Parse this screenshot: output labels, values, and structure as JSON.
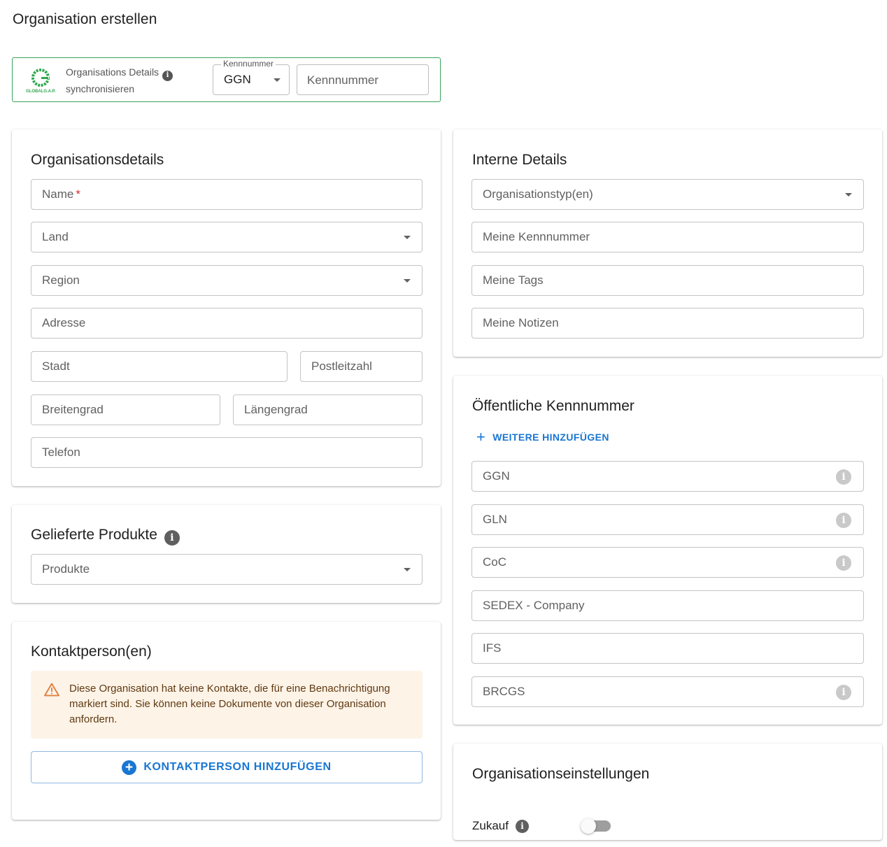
{
  "page": {
    "title": "Organisation erstellen"
  },
  "sync": {
    "label_line1": "Organisations Details",
    "label_line2": "synchronisieren",
    "logo_text": "GLOBALG.A.P.",
    "id_type_legend": "Kennnummer",
    "id_type_value": "GGN",
    "id_input_placeholder": "Kennnummer"
  },
  "org_details": {
    "title": "Organisationsdetails",
    "name": "Name",
    "name_required": "*",
    "country": "Land",
    "region": "Region",
    "address": "Adresse",
    "city": "Stadt",
    "zip": "Postleitzahl",
    "latitude": "Breitengrad",
    "longitude": "Längengrad",
    "phone": "Telefon"
  },
  "products": {
    "title": "Gelieferte Produkte",
    "select": "Produkte"
  },
  "contacts": {
    "title": "Kontaktperson(en)",
    "warning": "Diese Organisation hat keine Kontakte, die für eine Benachrichtigung markiert sind. Sie können keine Dokumente von dieser Organisation anfordern.",
    "add_button": "KONTAKTPERSON HINZUFÜGEN"
  },
  "internal": {
    "title": "Interne Details",
    "org_types": "Organisationstyp(en)",
    "my_id": "Meine Kennnummer",
    "my_tags": "Meine Tags",
    "my_notes": "Meine Notizen"
  },
  "public_ids": {
    "title": "Öffentliche Kennnummer",
    "add_more": "WEITERE HINZUFÜGEN",
    "fields": [
      "GGN",
      "GLN",
      "CoC",
      "SEDEX - Company",
      "IFS",
      "BRCGS"
    ]
  },
  "settings": {
    "title": "Organisationseinstellungen",
    "zukauf_label": "Zukauf",
    "zukauf_enabled": false
  },
  "colors": {
    "accent": "#1976d2",
    "sync_border": "#3aa35a",
    "logo_green": "#2fa84f",
    "warning_bg": "#fdf3e7",
    "warning_icon": "#e07b39",
    "required": "#d32f2f"
  }
}
